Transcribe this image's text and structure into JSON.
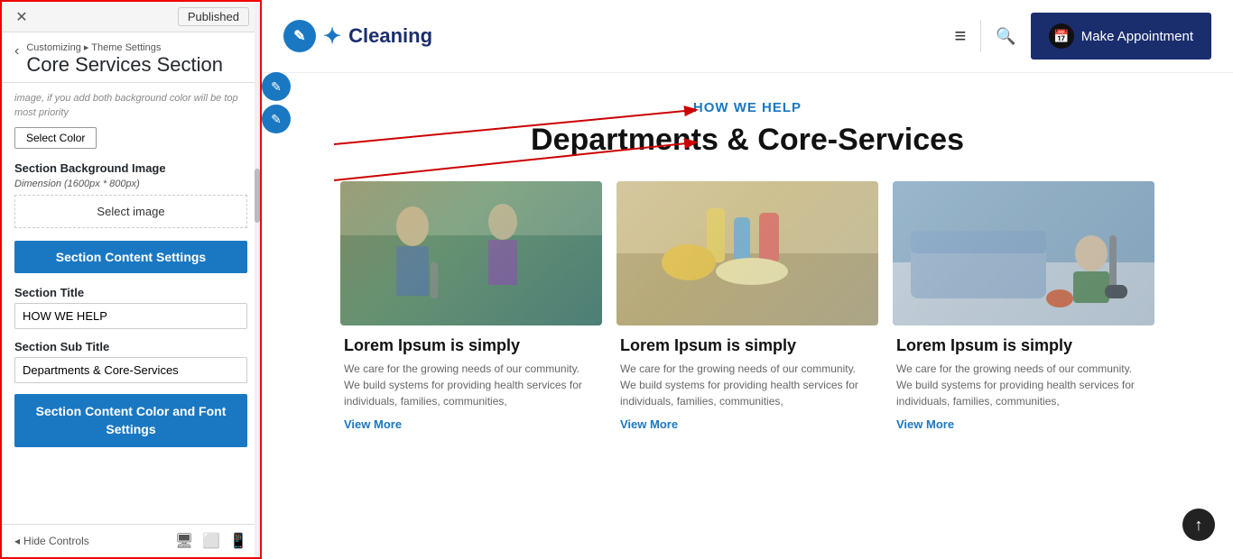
{
  "topBar": {
    "closeLabel": "✕",
    "publishedLabel": "Published"
  },
  "panelHeader": {
    "backArrow": "‹",
    "breadcrumb": "Customizing ▸ Theme Settings",
    "sectionTitle": "Core Services Section"
  },
  "panelBody": {
    "blurredText": "image, if you add both background color will be top most priority",
    "selectColorBtn": "Select Color",
    "bgImageLabel": "Section Background Image",
    "bgImageDimension": "Dimension (1600px * 800px)",
    "selectImageBtn": "Select image",
    "sectionContentBtn": "Section Content Settings",
    "sectionTitleLabel": "Section Title",
    "sectionTitleValue": "HOW WE HELP",
    "sectionSubTitleLabel": "Section Sub Title",
    "sectionSubTitleValue": "Departments & Core-Services",
    "colorFontBtn1": "Section Content Color and Font",
    "colorFontBtn2": "Settings"
  },
  "panelFooter": {
    "hideControls": "Hide Controls",
    "eyeIcon": "◂",
    "desktopIcon": "🖥",
    "tabletIcon": "⬜",
    "mobileIcon": "📱"
  },
  "navbar": {
    "logoText": "Cleaning",
    "logoIconChar": "✎",
    "sparkle": "✦",
    "hamburgerIcon": "≡",
    "searchIcon": "🔍",
    "appointmentBtn": "Make Appointment",
    "appointmentIconChar": "📅"
  },
  "heroSection": {
    "subtitle": "HOW WE HELP",
    "title": "Departments & Core-Services"
  },
  "cards": [
    {
      "title": "Lorem Ipsum is simply",
      "text": "We care for the growing needs of our community. We build systems for providing health services for individuals, families, communities,",
      "viewMore": "View More"
    },
    {
      "title": "Lorem Ipsum is simply",
      "text": "We care for the growing needs of our community. We build systems for providing health services for individuals, families, communities,",
      "viewMore": "View More"
    },
    {
      "title": "Lorem Ipsum is simply",
      "text": "We care for the growing needs of our community. We build systems for providing health services for individuals, families, communities,",
      "viewMore": "View More"
    }
  ],
  "scrollUpBtn": "↑",
  "colors": {
    "accent": "#1a78c2",
    "dark": "#1a2e6e",
    "redArrow": "#cc0000"
  }
}
